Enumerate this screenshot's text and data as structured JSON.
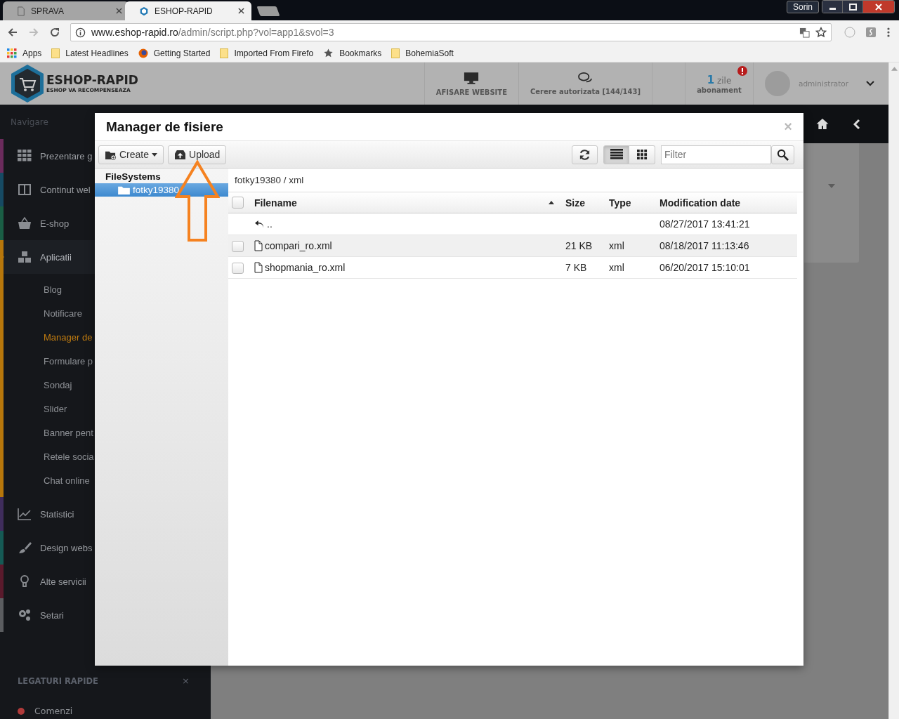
{
  "browser": {
    "tabs": [
      {
        "title": "SPRAVA",
        "selected": false
      },
      {
        "title": "ESHOP-RAPID",
        "selected": true
      }
    ],
    "profile": "Sorin",
    "url_host": "www.eshop-rapid.ro",
    "url_path": "/admin/script.php?vol=app1&svol=3",
    "bookmarks": [
      {
        "kind": "apps",
        "label": "Apps"
      },
      {
        "kind": "folder",
        "label": "Latest Headlines"
      },
      {
        "kind": "firefox",
        "label": "Getting Started"
      },
      {
        "kind": "folder",
        "label": "Imported From Firefo"
      },
      {
        "kind": "star",
        "label": "Bookmarks"
      },
      {
        "kind": "folder",
        "label": "BohemiaSoft"
      }
    ]
  },
  "header": {
    "logo_title": "ESHOP-RAPID",
    "logo_tagline": "ESHOP VA RECOMPENSEAZA",
    "actions": [
      {
        "kind": "monitor",
        "label": "AFISARE WEBSITE"
      },
      {
        "kind": "chat",
        "label": "Cerere autorizata [144/143]"
      }
    ],
    "subscription": {
      "count": "1",
      "unit": "zile",
      "label": "abonament"
    },
    "user": "administrator"
  },
  "sidebar": {
    "heading": "Navigare",
    "items": [
      {
        "label": "Prezentare g",
        "color": "#6b2b5c",
        "selected": false
      },
      {
        "label": "Continut wel",
        "color": "#164a63",
        "selected": false
      },
      {
        "label": "E-shop",
        "color": "#1a5e45",
        "selected": false
      },
      {
        "label": "Aplicatii",
        "color": "#b7770b",
        "selected": true,
        "children": [
          {
            "label": "Blog",
            "selected": false
          },
          {
            "label": "Notificare",
            "selected": false
          },
          {
            "label": "Manager de",
            "selected": true
          },
          {
            "label": "Formulare p",
            "selected": false
          },
          {
            "label": "Sondaj",
            "selected": false
          },
          {
            "label": "Slider",
            "selected": false
          },
          {
            "label": "Banner pent",
            "selected": false
          },
          {
            "label": "Retele socia",
            "selected": false
          },
          {
            "label": "Chat online",
            "selected": false
          }
        ]
      },
      {
        "label": "Statistici",
        "color": "#3f2d5c",
        "selected": false
      },
      {
        "label": "Design webs",
        "color": "#155a55",
        "selected": false
      },
      {
        "label": "Alte servicii",
        "color": "#5a1a2c",
        "selected": false
      },
      {
        "label": "Setari",
        "color": "#5b5d60",
        "selected": false
      }
    ],
    "quick_links": {
      "title": "LEGATURI RAPIDE",
      "close": "×",
      "items": [
        {
          "label": "Comenzi",
          "color": "#b03a3a"
        }
      ]
    }
  },
  "modal": {
    "title": "Manager de fisiere",
    "close": "×",
    "toolbar": {
      "create": "Create",
      "upload": "Upload",
      "filter_placeholder": "Filter",
      "views": [
        {
          "kind": "list",
          "selected": true
        },
        {
          "kind": "grid",
          "selected": false
        }
      ]
    },
    "tree": {
      "title": "FileSystems",
      "items": [
        {
          "label": "fotky19380",
          "selected": true
        }
      ]
    },
    "breadcrumb": "fotky19380 / xml",
    "table": {
      "all_checked": false,
      "columns": [
        {
          "label": "Filename",
          "sorted": true
        },
        {
          "label": "Size",
          "sorted": false
        },
        {
          "label": "Type",
          "sorted": false
        },
        {
          "label": "Modification date",
          "sorted": false
        }
      ],
      "rows": [
        {
          "kind": "parent",
          "name": "..",
          "date": "08/27/2017 13:41:21",
          "highlighted": false
        },
        {
          "kind": "file",
          "name": "compari_ro.xml",
          "size": "21 KB",
          "type": "xml",
          "date": "08/18/2017 11:13:46",
          "highlighted": true,
          "checked": false
        },
        {
          "kind": "file",
          "name": "shopmania_ro.xml",
          "size": "7 KB",
          "type": "xml",
          "date": "06/20/2017 15:10:01",
          "highlighted": false,
          "checked": false
        }
      ]
    }
  }
}
